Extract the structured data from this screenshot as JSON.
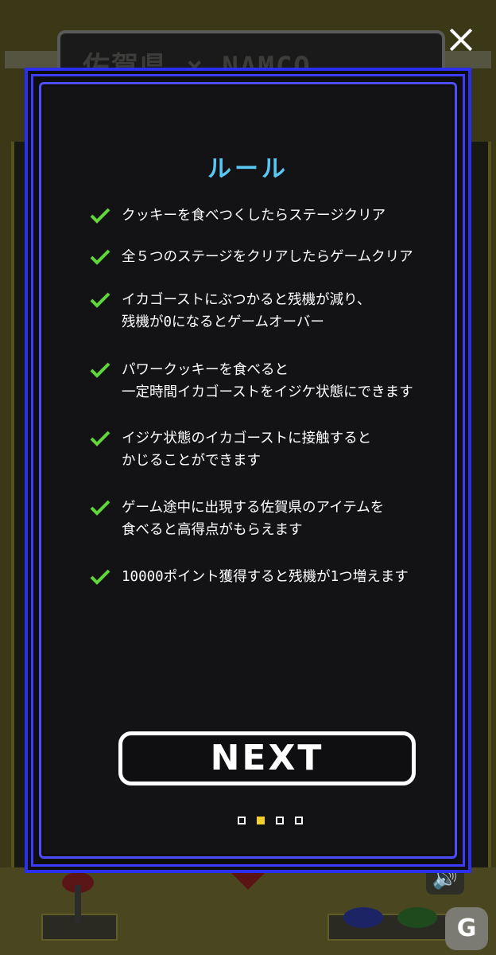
{
  "background": {
    "marquee_text": "佐賀県 × NAMCO"
  },
  "modal": {
    "title": "ルール",
    "rules": [
      "クッキーを食べつくしたらステージクリア",
      "全５つのステージをクリアしたらゲームクリア",
      "イカゴーストにぶつかると残機が減り、\n残機が0になるとゲームオーバー",
      "パワークッキーを食べると\n一定時間イカゴーストをイジケ状態にできます",
      "イジケ状態のイカゴーストに接触すると\nかじることができます",
      "ゲーム途中に出現する佐賀県のアイテムを\n食べると高得点がもらえます",
      "10000ポイント獲得すると残機が1つ増えます"
    ],
    "next_label": "NEXT",
    "pager": {
      "total": 4,
      "current": 2
    }
  },
  "icons": {
    "close": "close-icon",
    "check": "check-icon",
    "sound": "sound-icon",
    "logo": "logo-icon"
  },
  "colors": {
    "frame_blue": "#2b2ff0",
    "title_cyan": "#5ac8f5",
    "check_green": "#5fd63a",
    "active_dot_yellow": "#f3cf2a"
  },
  "corner_logo_text": "G"
}
